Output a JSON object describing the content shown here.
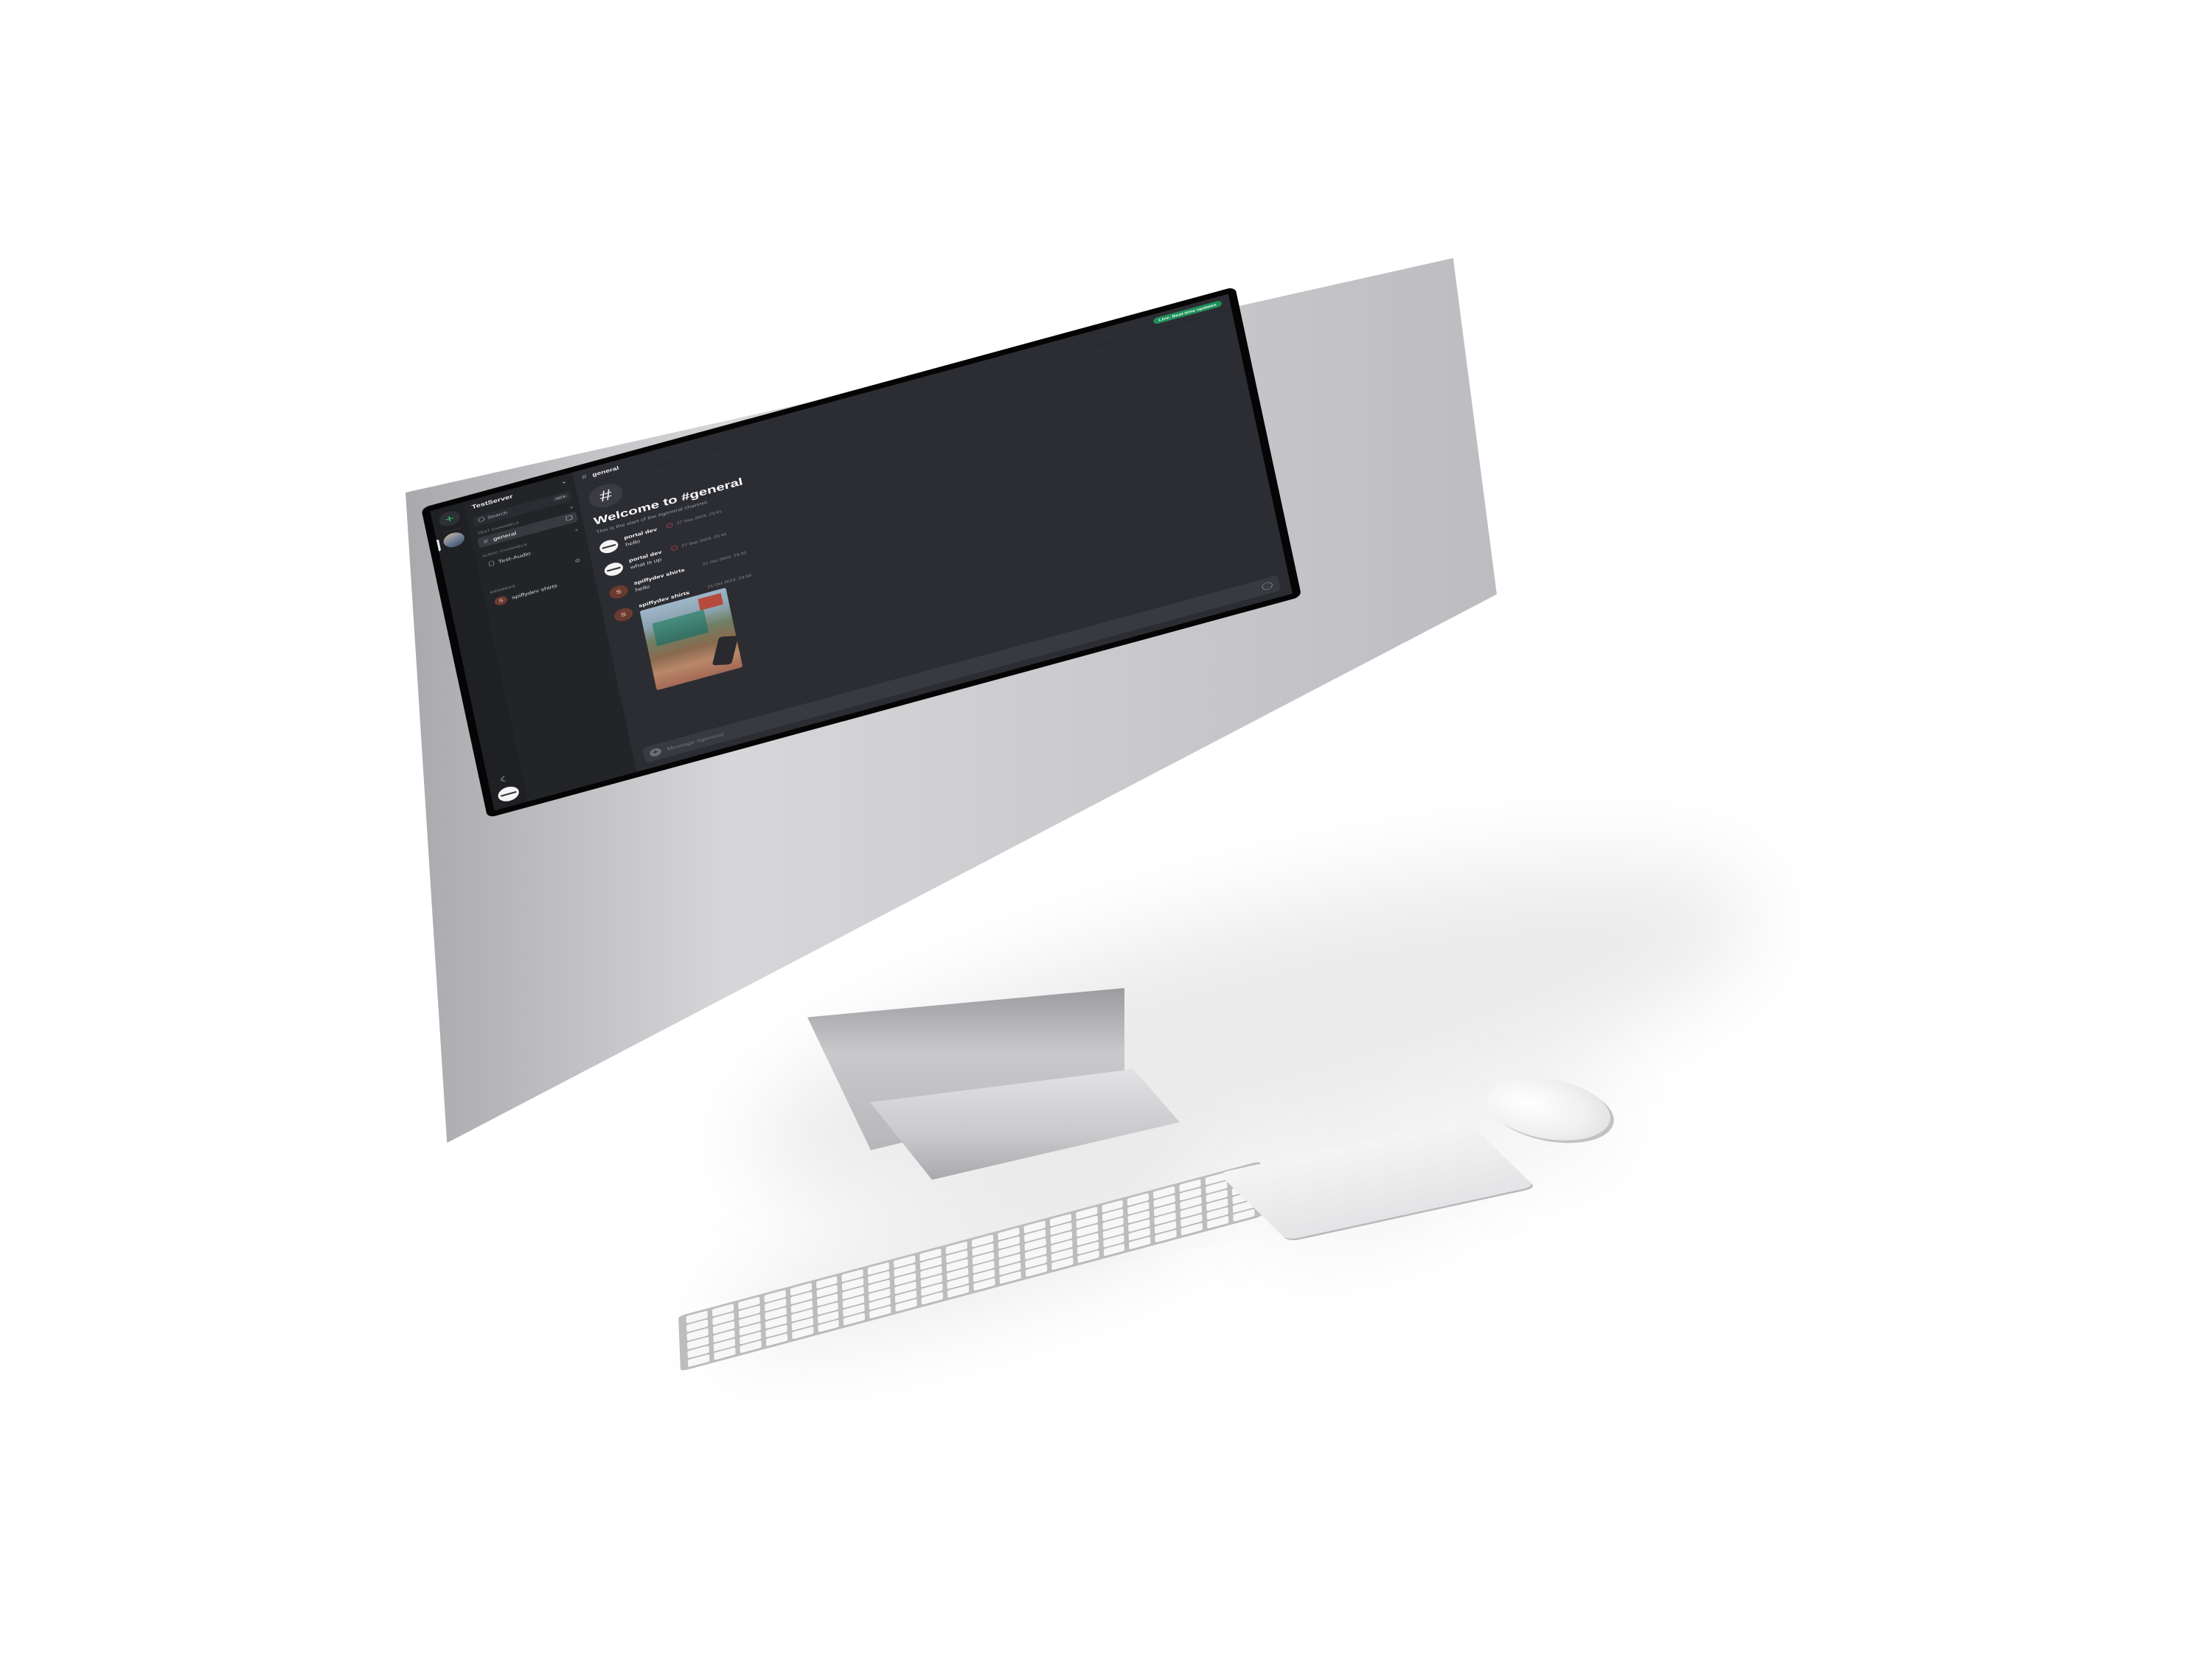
{
  "app": {
    "server_name": "TestServer",
    "live_badge": "Live: Real-time updates"
  },
  "sidebar": {
    "search_label": "Search",
    "search_shortcut": "ctrl k",
    "sections": {
      "text_channels": "TEXT CHANNELS",
      "audio_channels": "AUDIO CHANNELS",
      "members": "MEMBERS"
    },
    "text_channels": [
      {
        "label": "general",
        "active": true
      }
    ],
    "audio_channels": [
      {
        "label": "Test-Audio"
      }
    ],
    "members": [
      {
        "initial": "S",
        "name": "spiffydev shirts"
      }
    ]
  },
  "channel": {
    "name": "general",
    "welcome_title": "Welcome to #general",
    "welcome_subtitle": "This is the start of the #general channel."
  },
  "messages": [
    {
      "author": "portal dev",
      "time": "27 Sep 2023, 23:41",
      "text": "hello",
      "avatar": "logo",
      "moderator": true
    },
    {
      "author": "portal dev",
      "time": "27 Sep 2023, 23:41",
      "text": "what is up",
      "avatar": "logo",
      "moderator": true
    },
    {
      "author": "spiffydev shirts",
      "initial": "S",
      "time": "21 Oct 2023, 23:32",
      "text": "hello",
      "avatar": "initial"
    },
    {
      "author": "spiffydev shirts",
      "initial": "S",
      "time": "21 Oct 2023, 23:33",
      "text": "",
      "avatar": "initial",
      "attachment": "game-screenshot"
    }
  ],
  "composer": {
    "placeholder": "Message #general"
  },
  "icons": {
    "add": "plus-icon",
    "theme": "moon-icon",
    "lock": "lock-icon",
    "settings": "gear-icon",
    "emoji": "smiley-icon"
  },
  "colors": {
    "accent_green": "#2fbf71",
    "live_badge": "#1f8f5a",
    "moderator_badge": "#e0445e",
    "member_avatar": "#6b3b30"
  }
}
